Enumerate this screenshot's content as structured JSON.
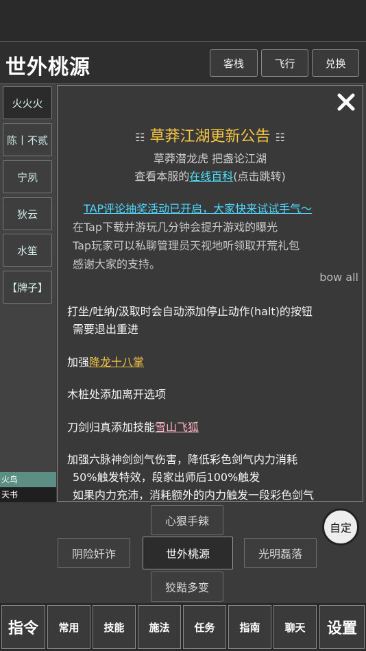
{
  "header": {
    "title": "世外桃源",
    "buttons": [
      "客栈",
      "飞行",
      "兑换"
    ]
  },
  "sidebar": {
    "items": [
      "火火火",
      "陈丨不贰",
      "宁夙",
      "狄云",
      "水笙",
      "【牌子】"
    ]
  },
  "status": {
    "line1": "火鸟",
    "line2": "天书"
  },
  "notice": {
    "title": "草莽江湖更新公告",
    "subtitle": "草莽潜龙虎 把盏论江湖",
    "wiki_prefix": "查看本服的",
    "wiki_link": "在线百科",
    "wiki_suffix": "(点击跳转)",
    "tap_headline": "TAP评论抽奖活动已开启，大家快来试试手气～",
    "tap_lines": [
      "在Tap下载并游玩几分钟会提升游戏的曝光",
      "Tap玩家可以私聊管理员天视地听领取开荒礼包",
      "感谢大家的支持。"
    ],
    "bow": "bow all",
    "line1": "打坐/吐纳/汲取时会自动添加停止动作(halt)的按钮",
    "line1b": "需要退出重进",
    "line2_prefix": "加强",
    "line2_link": "降龙十八掌",
    "line3": "木桩处添加离开选项",
    "line4_prefix": "刀剑归真添加技能",
    "line4_link": "雪山飞狐",
    "line5": "加强六脉神剑剑气伤害，降低彩色剑气内力消耗",
    "line5b": "50%触发特效，段家出师后100%触发",
    "line5c": "如果内力充沛，消耗额外的内力触发一段彩色剑气"
  },
  "faction": {
    "top": "心狠手辣",
    "left": "阴险奸诈",
    "center": "世外桃源",
    "right": "光明磊落",
    "bottom": "狡黠多变"
  },
  "custom_button": "自定",
  "bottom_bar": [
    "指令",
    "常用",
    "技能",
    "施法",
    "任务",
    "指南",
    "聊天",
    "设置"
  ]
}
